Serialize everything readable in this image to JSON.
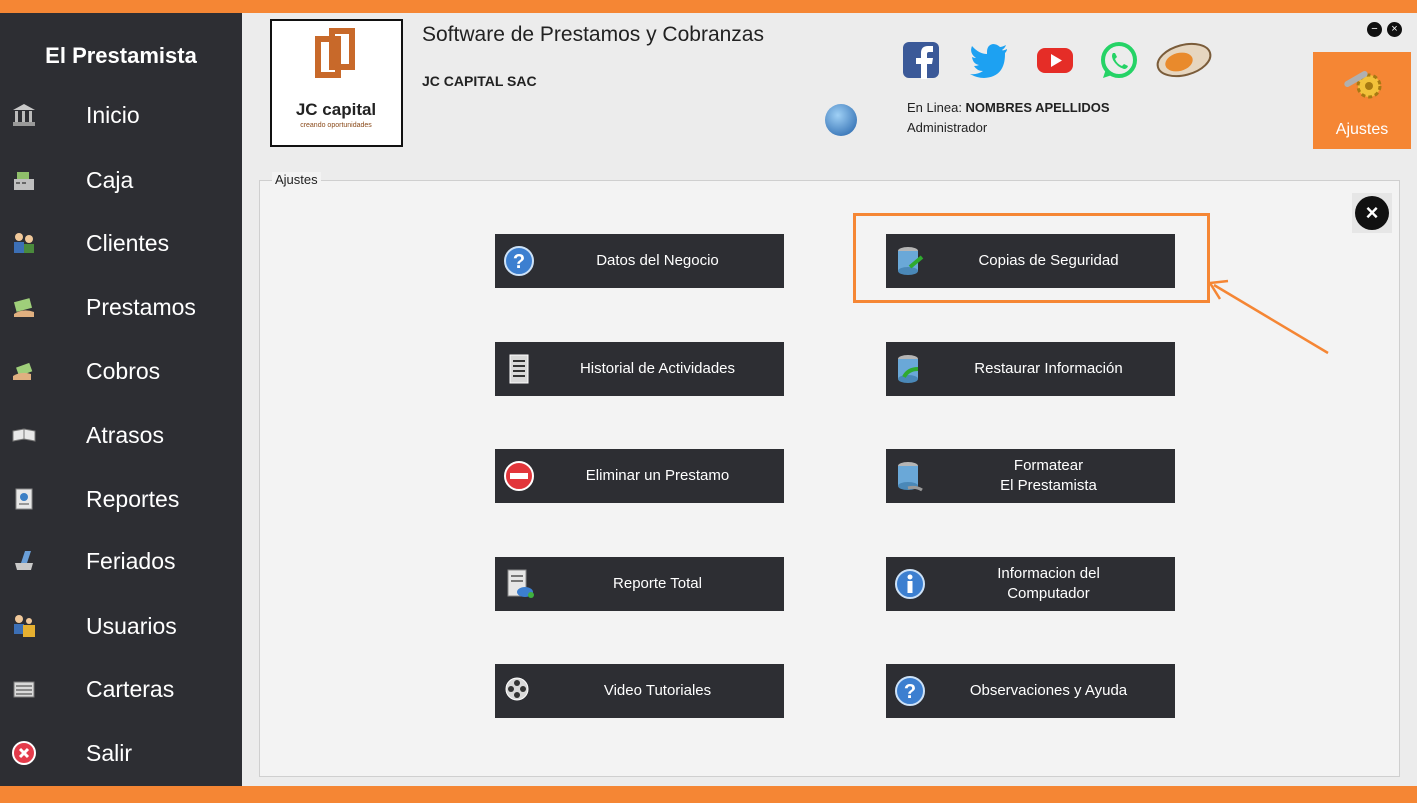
{
  "sidebar": {
    "title": "El Prestamista",
    "items": [
      {
        "label": "Inicio",
        "icon": "bank-icon"
      },
      {
        "label": "Caja",
        "icon": "cash-register-icon"
      },
      {
        "label": "Clientes",
        "icon": "clients-icon"
      },
      {
        "label": "Prestamos",
        "icon": "loan-icon"
      },
      {
        "label": "Cobros",
        "icon": "payment-icon"
      },
      {
        "label": "Atrasos",
        "icon": "delay-icon"
      },
      {
        "label": "Reportes",
        "icon": "report-icon"
      },
      {
        "label": "Feriados",
        "icon": "holiday-icon"
      },
      {
        "label": "Usuarios",
        "icon": "users-icon"
      },
      {
        "label": "Carteras",
        "icon": "portfolio-icon"
      },
      {
        "label": "Salir",
        "icon": "exit-icon"
      }
    ]
  },
  "header": {
    "logo_brand": "JC capital",
    "logo_tagline": "creando oportunidades",
    "app_title": "Software de Prestamos y Cobranzas",
    "company": "JC CAPITAL SAC",
    "online_prefix": "En Linea: ",
    "online_user": "NOMBRES APELLIDOS",
    "role": "Administrador",
    "settings_label": "Ajustes",
    "social": [
      "facebook-icon",
      "twitter-icon",
      "youtube-icon",
      "whatsapp-icon",
      "mouse-icon"
    ]
  },
  "panel": {
    "title": "Ajustes",
    "buttons": [
      {
        "label": "Datos del Negocio",
        "icon": "help-icon"
      },
      {
        "label": "Copias de Seguridad",
        "icon": "backup-icon"
      },
      {
        "label": "Historial de Actividades",
        "icon": "history-icon"
      },
      {
        "label": "Restaurar Información",
        "icon": "restore-icon"
      },
      {
        "label": "Eliminar un Prestamo",
        "icon": "delete-icon"
      },
      {
        "label": "Formatear\nEl Prestamista",
        "icon": "format-icon"
      },
      {
        "label": "Reporte Total",
        "icon": "total-report-icon"
      },
      {
        "label": "Informacion del\nComputador",
        "icon": "info-icon"
      },
      {
        "label": "Video Tutoriales",
        "icon": "film-icon"
      },
      {
        "label": "Observaciones y Ayuda",
        "icon": "help-icon"
      }
    ]
  },
  "colors": {
    "accent": "#f58634",
    "sidebar": "#2d2e33",
    "button": "#2d2e33"
  }
}
